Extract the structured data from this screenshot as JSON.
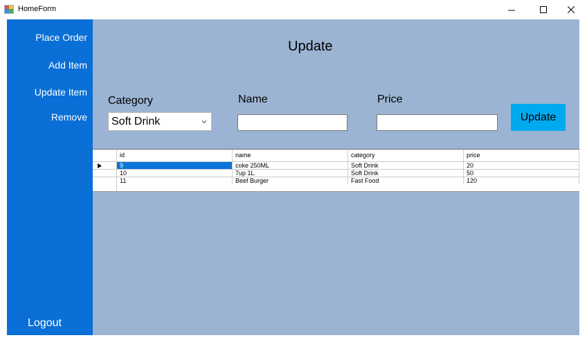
{
  "window": {
    "title": "HomeForm"
  },
  "sidebar": {
    "items": [
      {
        "label": "Place Order"
      },
      {
        "label": "Add Item"
      },
      {
        "label": "Update Item"
      },
      {
        "label": "Remove"
      }
    ],
    "logout_label": "Logout"
  },
  "main": {
    "heading": "Update",
    "labels": {
      "category": "Category",
      "name": "Name",
      "price": "Price"
    },
    "category_value": "Soft Drink",
    "name_value": "",
    "price_value": "",
    "update_button": "Update"
  },
  "table": {
    "columns": [
      "id",
      "name",
      "category",
      "price"
    ],
    "rows": [
      [
        "9",
        "coke 250ML",
        "Soft Drink",
        "20"
      ],
      [
        "10",
        "7up 1L",
        "Soft Drink",
        "50"
      ],
      [
        "11",
        "Beef Burger",
        "Fast Food",
        "120"
      ]
    ],
    "selected_row": 0
  },
  "colors": {
    "sidebar": "#0a6fd6",
    "content_bg": "#9bb4d3",
    "update_button": "#00aaee",
    "selection": "#0a74d8"
  }
}
